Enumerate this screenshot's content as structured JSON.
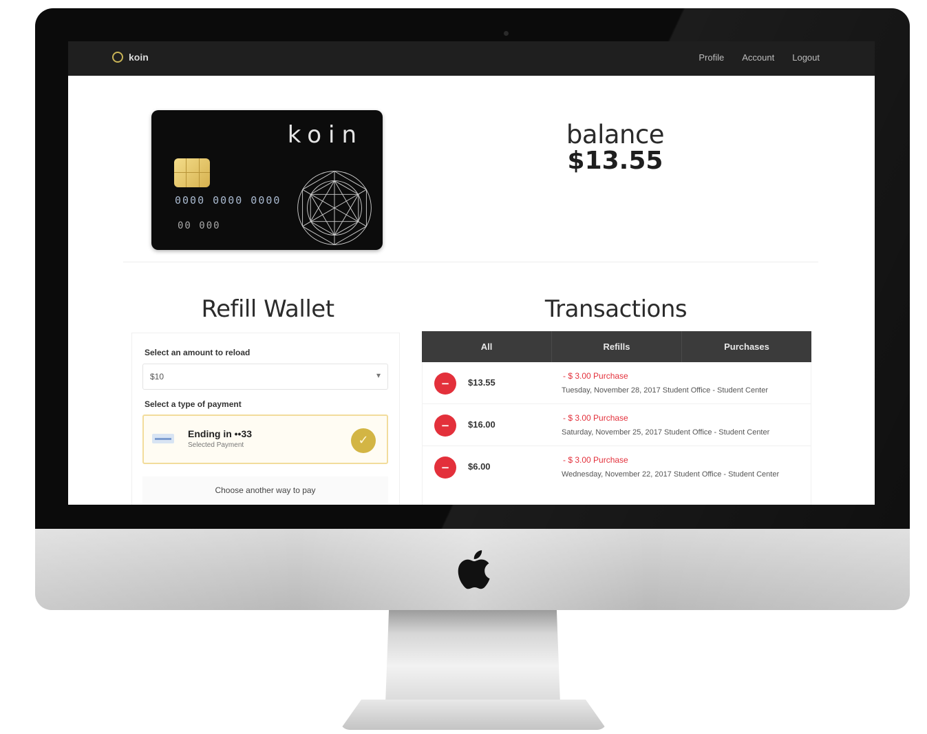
{
  "colors": {
    "navbar": "#1f1f1f",
    "accent_gold": "#d3b544",
    "negative_red": "#e3303b",
    "tab_bar": "#3b3b3b"
  },
  "nav": {
    "brand": "koin",
    "links": [
      "Profile",
      "Account",
      "Logout"
    ]
  },
  "card": {
    "brand": "koin",
    "number": "0000 0000 0000",
    "date": "00 000",
    "chip_icon": "chip-icon",
    "emblem_icon": "geometric-emblem-icon"
  },
  "balance": {
    "label": "balance",
    "value": "$13.55"
  },
  "refill": {
    "title": "Refill Wallet",
    "amount_label": "Select an amount to reload",
    "amount_value": "$10",
    "type_label": "Select a type of payment",
    "payment_title": "Ending in ••33",
    "payment_sub": "Selected Payment",
    "alt_pay": "Choose another way to pay"
  },
  "transactions": {
    "title": "Transactions",
    "tabs": [
      "All",
      "Refills",
      "Purchases"
    ],
    "items": [
      {
        "amount": "$13.55",
        "title": "- $ 3.00 Purchase",
        "detail": "Tuesday, November 28, 2017 Student Office - Student Center"
      },
      {
        "amount": "$16.00",
        "title": "- $ 3.00 Purchase",
        "detail": "Saturday, November 25, 2017 Student Office - Student Center"
      },
      {
        "amount": "$6.00",
        "title": "- $ 3.00 Purchase",
        "detail": "Wednesday, November 22, 2017 Student Office - Student Center"
      }
    ]
  }
}
